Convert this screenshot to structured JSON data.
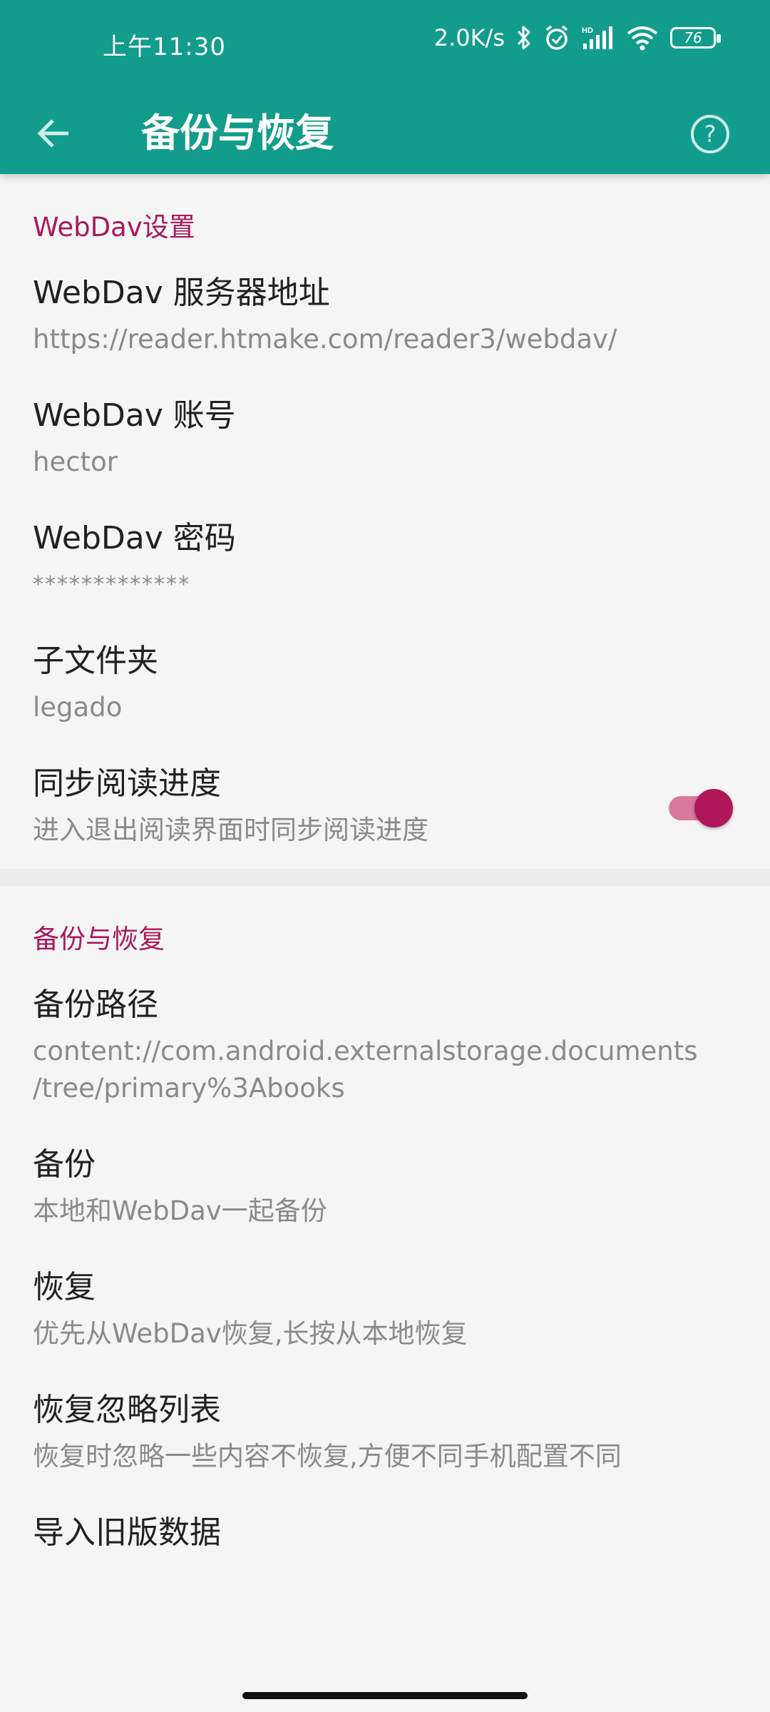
{
  "status_bar": {
    "time": "上午11:30",
    "network_speed": "2.0K/s",
    "battery_level": "76",
    "icons": [
      "bluetooth-icon",
      "alarm-icon",
      "hd-signal-icon",
      "wifi-icon",
      "battery-icon"
    ]
  },
  "toolbar": {
    "title": "备份与恢复",
    "back_icon": "arrow-back-icon",
    "help_icon": "help-circle-icon"
  },
  "colors": {
    "app_bar": "#129c8c",
    "accent": "#a9195c",
    "background": "#f5f5f5"
  },
  "sections": [
    {
      "header": "WebDav设置",
      "items": [
        {
          "title": "WebDav 服务器地址",
          "summary": "https://reader.htmake.com/reader3/webdav/"
        },
        {
          "title": "WebDav 账号",
          "summary": "hector"
        },
        {
          "title": "WebDav 密码",
          "summary": "*************"
        },
        {
          "title": "子文件夹",
          "summary": "legado"
        },
        {
          "title": "同步阅读进度",
          "summary": "进入退出阅读界面时同步阅读进度",
          "switch_on": true
        }
      ]
    },
    {
      "header": "备份与恢复",
      "items": [
        {
          "title": "备份路径",
          "summary": "content://com.android.externalstorage.documents\n/tree/primary%3Abooks"
        },
        {
          "title": "备份",
          "summary": "本地和WebDav一起备份"
        },
        {
          "title": "恢复",
          "summary": "优先从WebDav恢复,长按从本地恢复"
        },
        {
          "title": "恢复忽略列表",
          "summary": "恢复时忽略一些内容不恢复,方便不同手机配置不同"
        },
        {
          "title": "导入旧版数据",
          "summary": ""
        }
      ]
    }
  ]
}
